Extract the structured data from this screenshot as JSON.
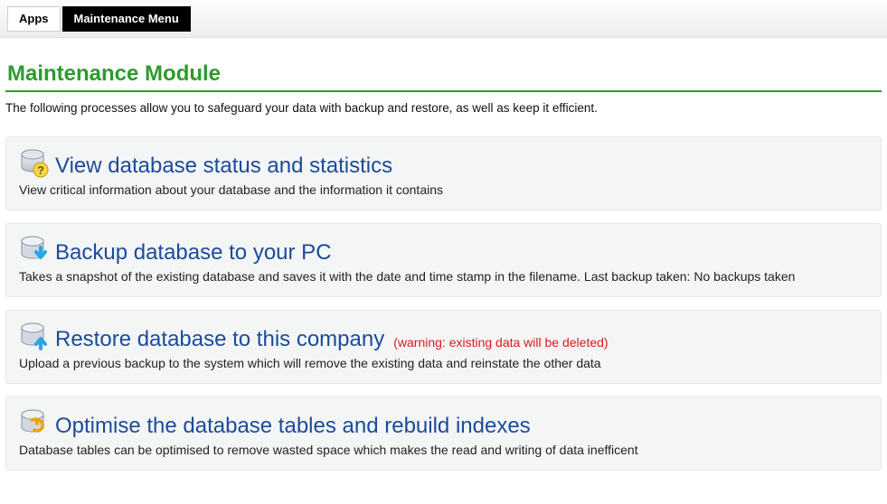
{
  "menu": {
    "apps": "Apps",
    "maintenance": "Maintenance Menu"
  },
  "title": "Maintenance Module",
  "intro": "The following processes allow you to safeguard your data with backup and restore, as well as keep it efficient.",
  "panels": {
    "status": {
      "title": "View database status and statistics",
      "desc": "View critical information about your database and the information it contains"
    },
    "backup": {
      "title": "Backup database to your PC",
      "desc": "Takes a snapshot of the existing database and saves it with the date and time stamp in the filename. Last backup taken: No backups taken"
    },
    "restore": {
      "title": "Restore database to this company",
      "warn": "(warning: existing data will be deleted)",
      "desc": "Upload a previous backup to the system which will remove the existing data and reinstate the other data"
    },
    "optimise": {
      "title": "Optimise the database tables and rebuild indexes",
      "desc": "Database tables can be optimised to remove wasted space which makes the read and writing of data inefficent"
    }
  }
}
